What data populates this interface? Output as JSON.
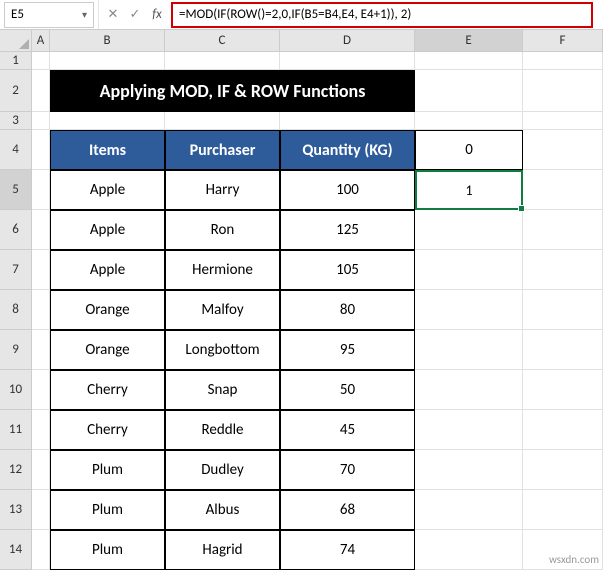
{
  "nameBox": {
    "value": "E5"
  },
  "formulaBar": {
    "cancelIcon": "✕",
    "acceptIcon": "✓",
    "fxLabel": "fx",
    "formula": "=MOD(IF(ROW()=2,0,IF(B5=B4,E4, E4+1)), 2)"
  },
  "columns": {
    "A": "A",
    "B": "B",
    "C": "C",
    "D": "D",
    "E": "E",
    "F": "F"
  },
  "rowNums": {
    "r1": "1",
    "r2": "2",
    "r3": "3",
    "r4": "4",
    "r5": "5",
    "r6": "6",
    "r7": "7",
    "r8": "8",
    "r9": "9",
    "r10": "10",
    "r11": "11",
    "r12": "12",
    "r13": "13",
    "r14": "14"
  },
  "title": "Applying MOD, IF & ROW Functions",
  "headers": {
    "items": "Items",
    "purchaser": "Purchaser",
    "quantity": "Quantity (KG)",
    "extra": "0"
  },
  "data": [
    {
      "item": "Apple",
      "purchaser": "Harry",
      "qty": "100",
      "extra": "1"
    },
    {
      "item": "Apple",
      "purchaser": "Ron",
      "qty": "125",
      "extra": ""
    },
    {
      "item": "Apple",
      "purchaser": "Hermione",
      "qty": "105",
      "extra": ""
    },
    {
      "item": "Orange",
      "purchaser": "Malfoy",
      "qty": "80",
      "extra": ""
    },
    {
      "item": "Orange",
      "purchaser": "Longbottom",
      "qty": "95",
      "extra": ""
    },
    {
      "item": "Cherry",
      "purchaser": "Snap",
      "qty": "50",
      "extra": ""
    },
    {
      "item": "Cherry",
      "purchaser": "Reddle",
      "qty": "45",
      "extra": ""
    },
    {
      "item": "Plum",
      "purchaser": "Dudley",
      "qty": "70",
      "extra": ""
    },
    {
      "item": "Plum",
      "purchaser": "Albus",
      "qty": "68",
      "extra": ""
    },
    {
      "item": "Plum",
      "purchaser": "Hagrid",
      "qty": "74",
      "extra": ""
    }
  ],
  "watermark": "wsxdn.com"
}
